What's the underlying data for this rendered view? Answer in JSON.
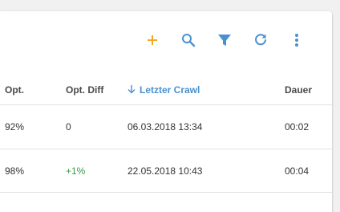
{
  "toolbar": {
    "icons": [
      {
        "name": "add-icon",
        "color": "#f5a623"
      },
      {
        "name": "search-icon",
        "color": "#4a90d0"
      },
      {
        "name": "filter-icon",
        "color": "#4a90d0"
      },
      {
        "name": "refresh-icon",
        "color": "#4a90d0"
      },
      {
        "name": "more-vert-icon",
        "color": "#4a90d0"
      }
    ]
  },
  "table": {
    "columns": {
      "opt": "Opt.",
      "opt_diff": "Opt. Diff",
      "last_crawl": "Letzter Crawl",
      "duration": "Dauer"
    },
    "sort": {
      "column": "last_crawl",
      "direction": "descending",
      "icon": "arrow-down-icon"
    },
    "rows": [
      {
        "opt": "92%",
        "opt_diff": "0",
        "last_crawl": "06.03.2018 13:34",
        "duration": "00:02"
      },
      {
        "opt": "98%",
        "opt_diff": "+1%",
        "last_crawl": "22.05.2018 10:43",
        "duration": "00:04"
      }
    ]
  },
  "colors": {
    "accent": "#4a90d0",
    "add": "#f5a623",
    "positive": "#3a9a4a"
  }
}
